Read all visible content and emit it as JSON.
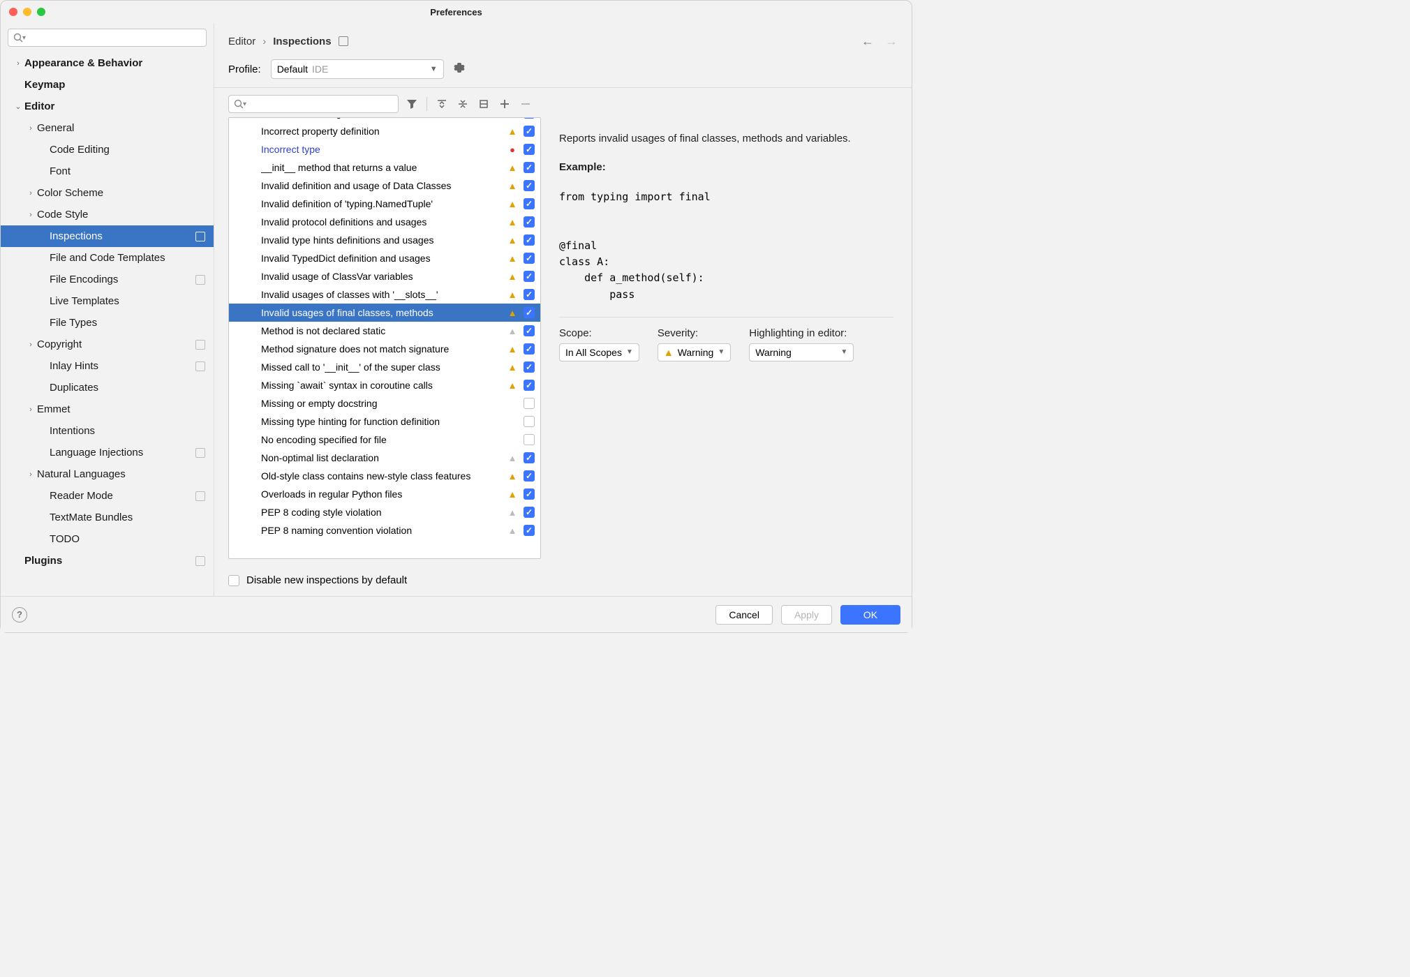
{
  "window": {
    "title": "Preferences"
  },
  "breadcrumb": {
    "parent": "Editor",
    "current": "Inspections"
  },
  "profile": {
    "label": "Profile:",
    "value": "Default",
    "hint": "IDE"
  },
  "sidebar": {
    "items": [
      {
        "label": "Appearance & Behavior",
        "depth": 0,
        "chev": "›",
        "bold": true
      },
      {
        "label": "Keymap",
        "depth": 0,
        "bold": true
      },
      {
        "label": "Editor",
        "depth": 0,
        "chev": "⌄",
        "bold": true
      },
      {
        "label": "General",
        "depth": 1,
        "chev": "›"
      },
      {
        "label": "Code Editing",
        "depth": 2
      },
      {
        "label": "Font",
        "depth": 2
      },
      {
        "label": "Color Scheme",
        "depth": 1,
        "chev": "›"
      },
      {
        "label": "Code Style",
        "depth": 1,
        "chev": "›"
      },
      {
        "label": "Inspections",
        "depth": 2,
        "selected": true,
        "badge": true
      },
      {
        "label": "File and Code Templates",
        "depth": 2
      },
      {
        "label": "File Encodings",
        "depth": 2,
        "badge": true
      },
      {
        "label": "Live Templates",
        "depth": 2
      },
      {
        "label": "File Types",
        "depth": 2
      },
      {
        "label": "Copyright",
        "depth": 1,
        "chev": "›",
        "badge": true
      },
      {
        "label": "Inlay Hints",
        "depth": 2,
        "badge": true
      },
      {
        "label": "Duplicates",
        "depth": 2
      },
      {
        "label": "Emmet",
        "depth": 1,
        "chev": "›"
      },
      {
        "label": "Intentions",
        "depth": 2
      },
      {
        "label": "Language Injections",
        "depth": 2,
        "badge": true
      },
      {
        "label": "Natural Languages",
        "depth": 1,
        "chev": "›"
      },
      {
        "label": "Reader Mode",
        "depth": 2,
        "badge": true
      },
      {
        "label": "TextMate Bundles",
        "depth": 2
      },
      {
        "label": "TODO",
        "depth": 2
      },
      {
        "label": "Plugins",
        "depth": 0,
        "bold": true,
        "badge": true
      }
    ]
  },
  "inspections": {
    "rows": [
      {
        "label": "Incorrect docstring",
        "icon": "gray",
        "checked": true,
        "cutoff": true
      },
      {
        "label": "Incorrect property definition",
        "icon": "yellow",
        "checked": true
      },
      {
        "label": "Incorrect type",
        "icon": "red",
        "checked": true,
        "highlight": true
      },
      {
        "label": "__init__ method that returns a value",
        "icon": "yellow",
        "checked": true
      },
      {
        "label": "Invalid definition and usage of Data Classes",
        "icon": "yellow",
        "checked": true
      },
      {
        "label": "Invalid definition of 'typing.NamedTuple'",
        "icon": "yellow",
        "checked": true
      },
      {
        "label": "Invalid protocol definitions and usages",
        "icon": "yellow",
        "checked": true
      },
      {
        "label": "Invalid type hints definitions and usages",
        "icon": "yellow",
        "checked": true
      },
      {
        "label": "Invalid TypedDict definition and usages",
        "icon": "yellow",
        "checked": true
      },
      {
        "label": "Invalid usage of ClassVar variables",
        "icon": "yellow",
        "checked": true
      },
      {
        "label": "Invalid usages of classes with '__slots__'",
        "icon": "yellow",
        "checked": true
      },
      {
        "label": "Invalid usages of final classes, methods",
        "icon": "yellow",
        "checked": true,
        "selected": true
      },
      {
        "label": "Method is not declared static",
        "icon": "gray",
        "checked": true
      },
      {
        "label": "Method signature does not match signature",
        "icon": "yellow",
        "checked": true
      },
      {
        "label": "Missed call to '__init__' of the super class",
        "icon": "yellow",
        "checked": true
      },
      {
        "label": "Missing `await` syntax in coroutine calls",
        "icon": "yellow",
        "checked": true
      },
      {
        "label": "Missing or empty docstring",
        "icon": "",
        "checked": false
      },
      {
        "label": "Missing type hinting for function definition",
        "icon": "",
        "checked": false
      },
      {
        "label": "No encoding specified for file",
        "icon": "",
        "checked": false
      },
      {
        "label": "Non-optimal list declaration",
        "icon": "gray",
        "checked": true
      },
      {
        "label": "Old-style class contains new-style class features",
        "icon": "yellow",
        "checked": true
      },
      {
        "label": "Overloads in regular Python files",
        "icon": "yellow",
        "checked": true
      },
      {
        "label": "PEP 8 coding style violation",
        "icon": "gray",
        "checked": true
      },
      {
        "label": "PEP 8 naming convention violation",
        "icon": "gray",
        "checked": true,
        "cutoff": true
      }
    ]
  },
  "detail": {
    "description": "Reports invalid usages of final classes, methods and variables.",
    "example_label": "Example:",
    "code": "from typing import final\n\n\n@final\nclass A:\n    def a_method(self):\n        pass",
    "scope": {
      "label": "Scope:",
      "value": "In All Scopes"
    },
    "severity": {
      "label": "Severity:",
      "value": "Warning"
    },
    "highlighting": {
      "label": "Highlighting in editor:",
      "value": "Warning"
    }
  },
  "disable_checkbox": {
    "label": "Disable new inspections by default"
  },
  "footer": {
    "cancel": "Cancel",
    "apply": "Apply",
    "ok": "OK"
  }
}
